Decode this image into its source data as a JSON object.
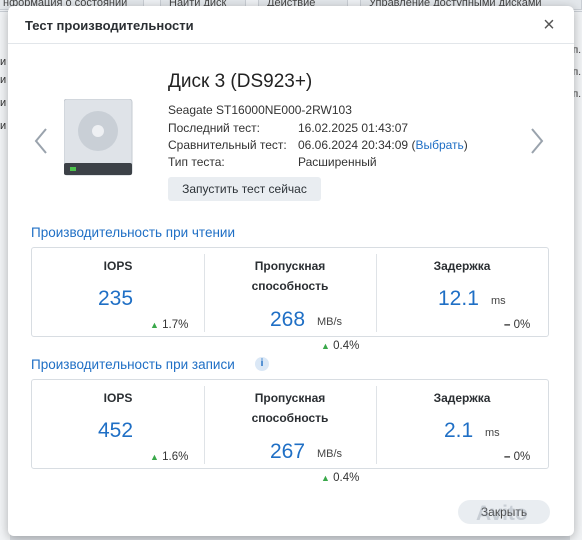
{
  "background": {
    "tabs": [
      "нформация о состоянии",
      "Найти диск",
      "Действие",
      "Управление доступными дисками"
    ],
    "left_letters": [
      "и",
      "и",
      "и",
      "и"
    ],
    "right_letters": [
      "п.",
      "п.",
      "п."
    ]
  },
  "dialog": {
    "title": "Тест производительности",
    "disk": {
      "name": "Диск 3 (DS923+)",
      "model": "Seagate ST16000NE000-2RW103",
      "last_test_label": "Последний тест:",
      "last_test_value": "16.02.2025 01:43:07",
      "compare_label": "Сравнительный тест:",
      "compare_value": "06.06.2024 20:34:09 (",
      "compare_link": "Выбрать",
      "compare_close": ")",
      "test_type_label": "Тип теста:",
      "test_type_value": "Расширенный",
      "run_button": "Запустить тест сейчас"
    },
    "read": {
      "title": "Производительность при чтении",
      "iops_label": "IOPS",
      "iops_value": "235",
      "iops_delta": "1.7%",
      "throughput_label_1": "Пропускная",
      "throughput_label_2": "способность",
      "throughput_value": "268",
      "throughput_unit": "MB/s",
      "throughput_delta": "0.4%",
      "latency_label": "Задержка",
      "latency_value": "12.1",
      "latency_unit": "ms",
      "latency_delta": "0%"
    },
    "write": {
      "title": "Производительность при записи",
      "info_icon": "i",
      "iops_label": "IOPS",
      "iops_value": "452",
      "iops_delta": "1.6%",
      "throughput_label_1": "Пропускная",
      "throughput_label_2": "способность",
      "throughput_value": "267",
      "throughput_unit": "MB/s",
      "throughput_delta": "0.4%",
      "latency_label": "Задержка",
      "latency_value": "2.1",
      "latency_unit": "ms",
      "latency_delta": "0%"
    },
    "close_button": "Закрыть"
  },
  "watermark": "Avito",
  "icons": {
    "up": "triangle-up-icon",
    "flat": "dash-icon",
    "prev": "chevron-left-icon",
    "next": "chevron-right-icon",
    "close": "close-icon"
  },
  "colors": {
    "accent": "#1f6fc5",
    "positive": "#3aa84a"
  }
}
